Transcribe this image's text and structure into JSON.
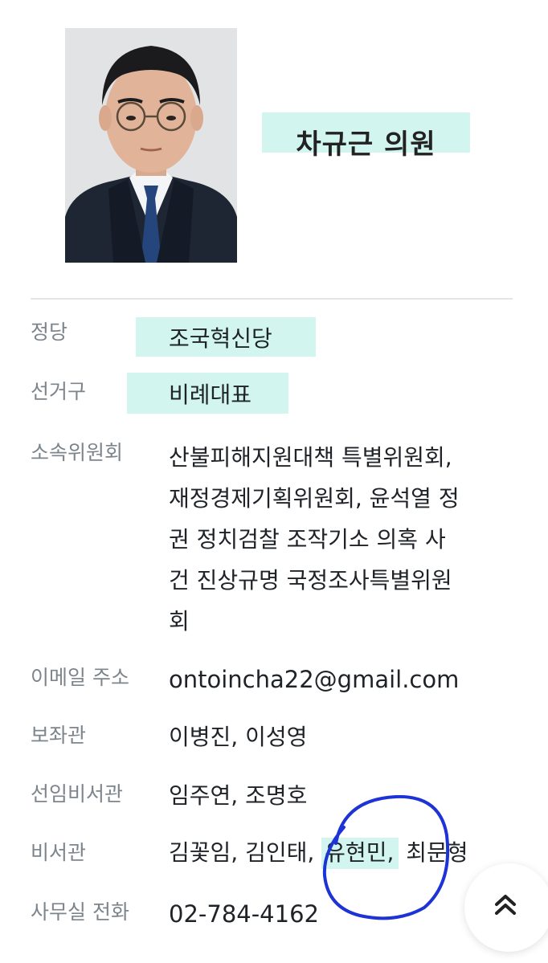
{
  "profile": {
    "name": "차규근 의원"
  },
  "fields": {
    "party": {
      "label": "정당",
      "value": "조국혁신당"
    },
    "district": {
      "label": "선거구",
      "value": "비례대표"
    },
    "committees": {
      "label": "소속위원회",
      "lines": [
        "산불피해지원대책 특별위원회,",
        "재정경제기획위원회, 윤석열 정",
        "권 정치검찰 조작기소 의혹 사",
        "건 진상규명 국정조사특별위원",
        "회"
      ]
    },
    "email": {
      "label": "이메일 주소",
      "value": "ontoincha22@gmail.com"
    },
    "aides": {
      "label": "보좌관",
      "value": "이병진, 이성영"
    },
    "senior_secretaries": {
      "label": "선임비서관",
      "value": "임주연, 조명호"
    },
    "secretaries": {
      "label": "비서관",
      "part1": "김꽃임, 김인태, ",
      "highlight": "유현민,",
      "part2": " 최문형"
    },
    "phone": {
      "label": "사무실 전화",
      "value": "02-784-4162"
    }
  },
  "icons": {
    "scroll_top": "double-chevron-up-icon"
  },
  "colors": {
    "highlight": "#d2f6ef",
    "label": "#7d858c",
    "ink_circle": "#1d33d6"
  }
}
